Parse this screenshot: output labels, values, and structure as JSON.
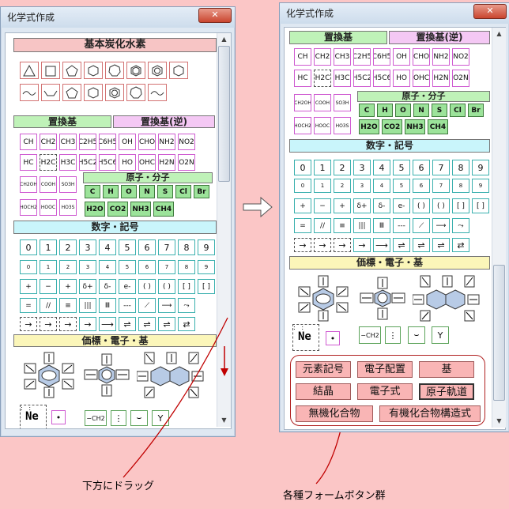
{
  "window_title": "化学式作成",
  "close_glyph": "✕",
  "sections": {
    "basic": "基本炭化水素",
    "sub": "置換基",
    "sub_rev": "置換基(逆)",
    "atom": "原子・分子",
    "num": "数字・記号",
    "val": "価標・電子・基"
  },
  "sub_row1": [
    "CH",
    "CH2",
    "CH3",
    "C2H5",
    "C6H5",
    "OH",
    "CHO",
    "NH2",
    "NO2"
  ],
  "sub_row2": [
    "HC",
    "H2C",
    "H3C",
    "H5C2",
    "H5C6",
    "HO",
    "OHC",
    "H2N",
    "O2N"
  ],
  "sub_left3": [
    "CH2OH",
    "COOH",
    "SO3H"
  ],
  "sub_left4": [
    "HOCH2",
    "HOOC",
    "HO3S"
  ],
  "atoms_row1": [
    "C",
    "H",
    "O",
    "N",
    "S",
    "Cl",
    "Br"
  ],
  "atoms_row2": [
    "H2O",
    "CO2",
    "NH3",
    "CH4"
  ],
  "digits": [
    "0",
    "1",
    "2",
    "3",
    "4",
    "5",
    "6",
    "7",
    "8",
    "9"
  ],
  "small_digits": [
    "0",
    "1",
    "2",
    "3",
    "4",
    "5",
    "6",
    "7",
    "8",
    "9"
  ],
  "symbols_row1": [
    "+",
    "−",
    "+",
    "δ+",
    "δ-",
    "e-",
    "( )",
    "( )",
    "[ ]",
    "[ ]"
  ],
  "symbols_row2": [
    "=",
    "//",
    "≡",
    "|||",
    "Ⅲ",
    "---",
    "⟋",
    "⟶",
    "⤳"
  ],
  "arrows_row": [
    "→",
    "→",
    "→",
    "→",
    "⟶",
    "⇌",
    "⇌",
    "⇌",
    "⇄"
  ],
  "ne_symbol": "Ne",
  "ch2_label": "−CH2",
  "form_buttons": [
    "元素記号",
    "電子配置",
    "基",
    "結晶",
    "電子式",
    "原子軌道",
    "無機化合物",
    "有機化合物構造式"
  ],
  "captions": {
    "drag": "下方にドラッグ",
    "buttons": "各種フォームボタン群"
  }
}
